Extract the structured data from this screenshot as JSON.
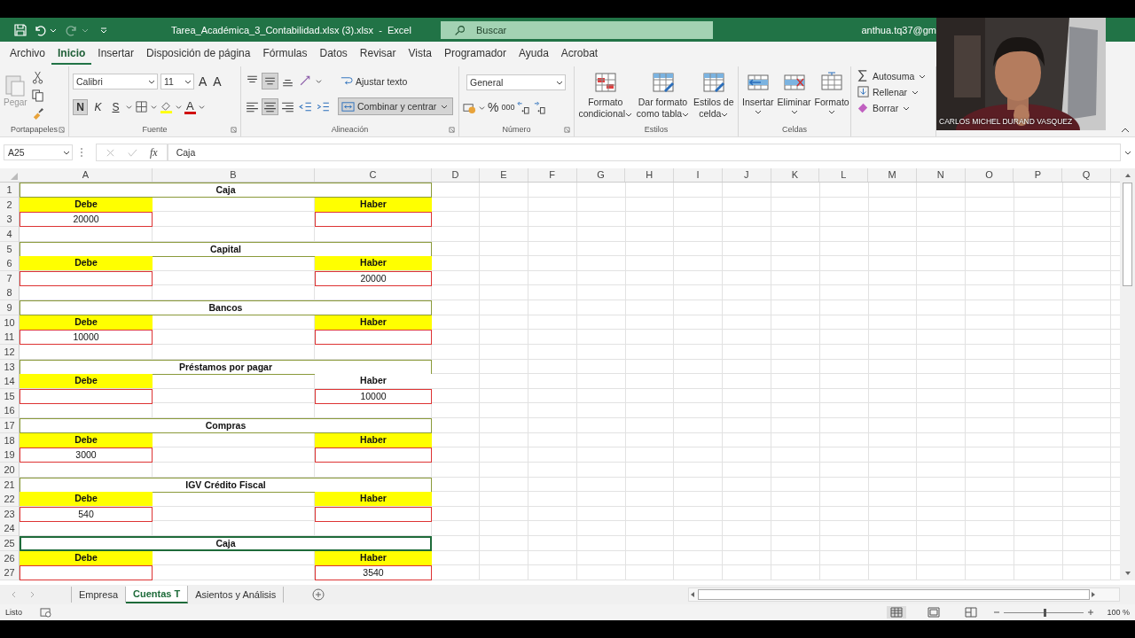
{
  "window": {
    "title": "Tarea_Académica_3_Contabilidad.xlsx (3).xlsx  -  Excel",
    "account": "anthua.tq37@gm"
  },
  "search": {
    "placeholder": "Buscar"
  },
  "tabs": [
    {
      "label": "Archivo",
      "selected": false
    },
    {
      "label": "Inicio",
      "selected": true
    },
    {
      "label": "Insertar",
      "selected": false
    },
    {
      "label": "Disposición de página",
      "selected": false
    },
    {
      "label": "Fórmulas",
      "selected": false
    },
    {
      "label": "Datos",
      "selected": false
    },
    {
      "label": "Revisar",
      "selected": false
    },
    {
      "label": "Vista",
      "selected": false
    },
    {
      "label": "Programador",
      "selected": false
    },
    {
      "label": "Ayuda",
      "selected": false
    },
    {
      "label": "Acrobat",
      "selected": false
    }
  ],
  "ribbon": {
    "clipboard": {
      "paste": "Pegar",
      "label": "Portapapeles"
    },
    "font": {
      "family": "Calibri",
      "size": "11",
      "grow": "A",
      "shrink": "A",
      "bold": "N",
      "italic": "K",
      "underline": "S",
      "color_letter": "A",
      "bold_on": true,
      "label": "Fuente"
    },
    "alignment": {
      "wrap": "Ajustar texto",
      "merge": "Combinar y centrar",
      "merge_on": true,
      "middle_on": true,
      "center_on": true,
      "label": "Alineación"
    },
    "number": {
      "format": "General",
      "percent": "%",
      "thousands": "000",
      "label": "Número"
    },
    "styles": {
      "buttons": [
        {
          "lines": [
            "Formato",
            "condicional"
          ]
        },
        {
          "lines": [
            "Dar formato",
            "como tabla"
          ]
        },
        {
          "lines": [
            "Estilos de",
            "celda"
          ]
        }
      ],
      "label": "Estilos"
    },
    "cells": {
      "buttons": [
        "Insertar",
        "Eliminar",
        "Formato"
      ],
      "label": "Celdas"
    },
    "editing": {
      "buttons": [
        "Autosuma",
        "Rellenar",
        "Borrar"
      ]
    }
  },
  "formula_bar": {
    "name_box": "A25",
    "fx": "fx",
    "formula": "Caja"
  },
  "sheet": {
    "columns": [
      "A",
      "B",
      "C",
      "D",
      "E",
      "F",
      "G",
      "H",
      "I",
      "J",
      "K",
      "L",
      "M",
      "N",
      "O",
      "P",
      "Q"
    ],
    "rows": [
      {
        "number": "1",
        "kind": "title",
        "text": "Caja",
        "selected": false
      },
      {
        "number": "2",
        "kind": "header",
        "debe": "Debe",
        "haber": "Haber",
        "debe_highlighted": true,
        "haber_highlighted": true
      },
      {
        "number": "3",
        "kind": "value",
        "debe": "20000"
      },
      {
        "number": "4",
        "kind": "blank"
      },
      {
        "number": "5",
        "kind": "title",
        "text": "Capital",
        "selected": false
      },
      {
        "number": "6",
        "kind": "header",
        "debe": "Debe",
        "haber": "Haber",
        "debe_highlighted": true,
        "haber_highlighted": true
      },
      {
        "number": "7",
        "kind": "value",
        "haber": "20000"
      },
      {
        "number": "8",
        "kind": "blank"
      },
      {
        "number": "9",
        "kind": "title",
        "text": "Bancos",
        "selected": false
      },
      {
        "number": "10",
        "kind": "header",
        "debe": "Debe",
        "haber": "Haber",
        "debe_highlighted": true,
        "haber_highlighted": true
      },
      {
        "number": "11",
        "kind": "value",
        "debe": "10000"
      },
      {
        "number": "12",
        "kind": "blank"
      },
      {
        "number": "13",
        "kind": "title",
        "text": "Préstamos por pagar",
        "selected": false
      },
      {
        "number": "14",
        "kind": "header",
        "debe": "Debe",
        "haber": "Haber",
        "debe_highlighted": true,
        "haber_highlighted": false
      },
      {
        "number": "15",
        "kind": "value",
        "haber": "10000"
      },
      {
        "number": "16",
        "kind": "blank"
      },
      {
        "number": "17",
        "kind": "title",
        "text": "Compras",
        "selected": false
      },
      {
        "number": "18",
        "kind": "header",
        "debe": "Debe",
        "haber": "Haber",
        "debe_highlighted": true,
        "haber_highlighted": true
      },
      {
        "number": "19",
        "kind": "value",
        "debe": "3000"
      },
      {
        "number": "20",
        "kind": "blank"
      },
      {
        "number": "21",
        "kind": "title",
        "text": "IGV Crédito Fiscal",
        "selected": false
      },
      {
        "number": "22",
        "kind": "header",
        "debe": "Debe",
        "haber": "Haber",
        "debe_highlighted": true,
        "haber_highlighted": true
      },
      {
        "number": "23",
        "kind": "value",
        "debe": "540"
      },
      {
        "number": "24",
        "kind": "blank"
      },
      {
        "number": "25",
        "kind": "title",
        "text": "Caja",
        "selected": true
      },
      {
        "number": "26",
        "kind": "header",
        "debe": "Debe",
        "haber": "Haber",
        "debe_highlighted": true,
        "haber_highlighted": true
      },
      {
        "number": "27",
        "kind": "value",
        "haber": "3540"
      }
    ]
  },
  "sheet_tabs": [
    {
      "label": "Empresa",
      "selected": false
    },
    {
      "label": "Cuentas T",
      "selected": true
    },
    {
      "label": "Asientos y Análisis",
      "selected": false
    }
  ],
  "status_bar": {
    "status": "Listo",
    "zoom": "100 %",
    "zoom_slider": {
      "level": 0.5
    }
  },
  "webcam": {
    "caption": "CARLOS MICHEL DURAND VASQUEZ"
  }
}
